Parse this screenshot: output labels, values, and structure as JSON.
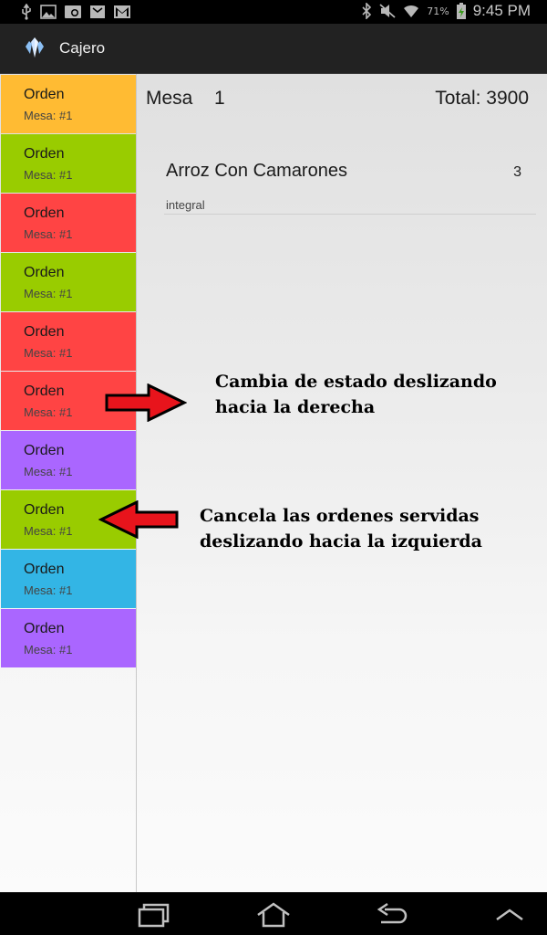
{
  "status_bar": {
    "battery_percent": "71%",
    "time": "9:45 PM",
    "left_icons": [
      "usb-icon",
      "image-icon",
      "sync-icon",
      "email-icon",
      "gmail-icon"
    ],
    "right_icons": [
      "bluetooth-icon",
      "mute-icon",
      "wifi-icon",
      "battery-icon"
    ]
  },
  "app": {
    "title": "Cajero",
    "icon": "app-logo-icon"
  },
  "orders": [
    {
      "title": "Orden",
      "subtitle": "Mesa: #1",
      "color": "#FFBB33"
    },
    {
      "title": "Orden",
      "subtitle": "Mesa: #1",
      "color": "#99CC00"
    },
    {
      "title": "Orden",
      "subtitle": "Mesa: #1",
      "color": "#FF4444"
    },
    {
      "title": "Orden",
      "subtitle": "Mesa: #1",
      "color": "#99CC00"
    },
    {
      "title": "Orden",
      "subtitle": "Mesa: #1",
      "color": "#FF4444"
    },
    {
      "title": "Orden",
      "subtitle": "Mesa: #1",
      "color": "#FF4444"
    },
    {
      "title": "Orden",
      "subtitle": "Mesa: #1",
      "color": "#AA66FF"
    },
    {
      "title": "Orden",
      "subtitle": "Mesa: #1",
      "color": "#99CC00"
    },
    {
      "title": "Orden",
      "subtitle": "Mesa: #1",
      "color": "#33B5E5"
    },
    {
      "title": "Orden",
      "subtitle": "Mesa: #1",
      "color": "#AA66FF"
    }
  ],
  "detail": {
    "mesa_label": "Mesa",
    "mesa_number": "1",
    "total": "Total: 3900",
    "items": [
      {
        "name": "Arroz Con Camarones",
        "quantity": "3",
        "note": "integral"
      }
    ]
  },
  "annotations": {
    "swipe_right_line1": "Cambia de estado deslizando",
    "swipe_right_line2": "hacia la derecha",
    "swipe_left_line1": "Cancela las ordenes servidas",
    "swipe_left_line2": "deslizando hacia la izquierda",
    "arrow_color": "#E8141C"
  },
  "nav_bar": {
    "buttons": [
      "recent-apps-icon",
      "home-icon",
      "back-icon",
      "menu-up-icon"
    ]
  }
}
